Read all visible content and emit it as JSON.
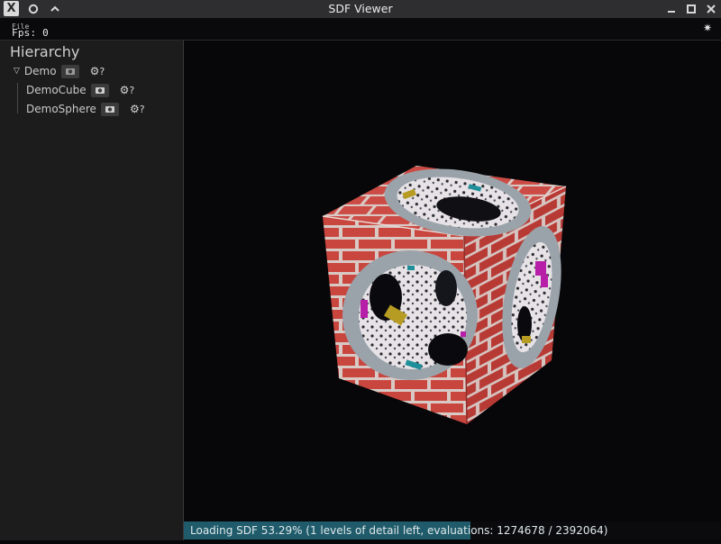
{
  "window": {
    "title": "SDF Viewer",
    "buttons": [
      "app-icon",
      "pin-icon",
      "chevron-up-icon",
      "minimize-icon",
      "maximize-icon",
      "close-icon"
    ]
  },
  "menubar": {
    "file_label": "File",
    "fps_text": "Fps: 0",
    "theme_icon": "sun-icon"
  },
  "hierarchy": {
    "title": "Hierarchy",
    "items": [
      {
        "label": "Demo",
        "expanded": true,
        "level": 0,
        "settings_label": "?"
      },
      {
        "label": "DemoCube",
        "level": 1,
        "settings_label": "?"
      },
      {
        "label": "DemoSphere",
        "level": 1,
        "settings_label": "?"
      }
    ]
  },
  "status": {
    "text": "Loading SDF 53.29% (1 levels of detail left, evaluations: 1274678 / 2392064)",
    "progress": 0.5329,
    "bar_color": "#1f5b6a"
  },
  "colors": {
    "brick": "#c9463f",
    "mortar": "#d9c9c5",
    "ring": "#9aa3aa",
    "background": "#070709"
  }
}
